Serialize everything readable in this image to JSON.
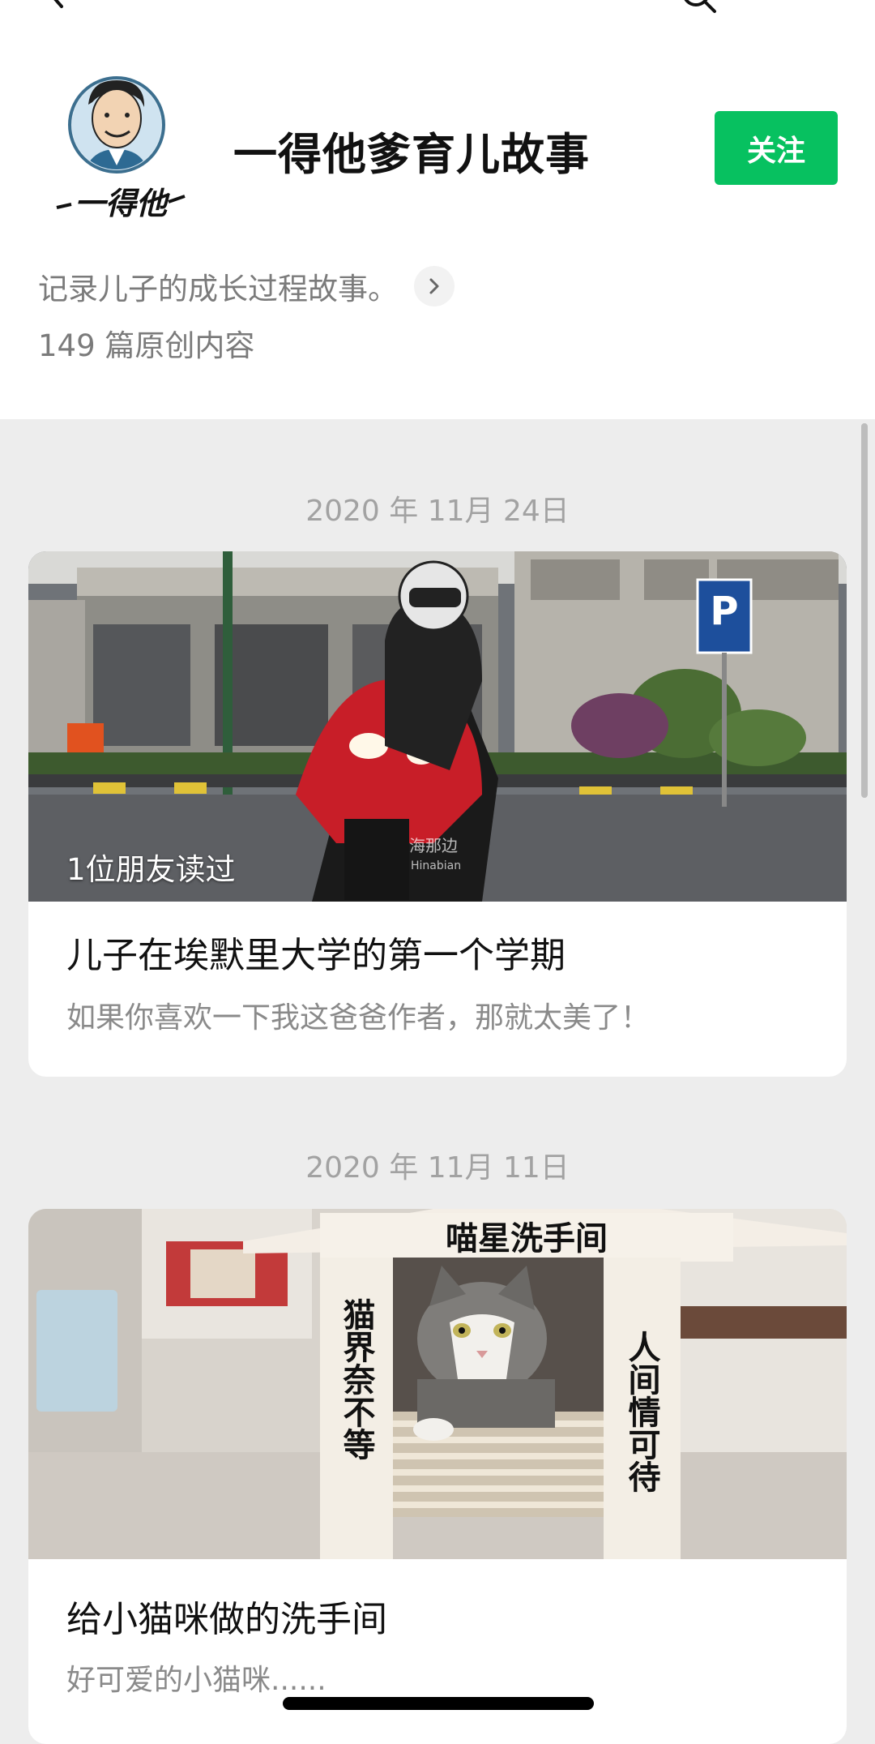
{
  "nav": {
    "back_icon": "chevron-left-icon",
    "search_icon": "search-icon"
  },
  "profile": {
    "name": "一得他爹育儿故事",
    "follow_label": "关注",
    "description": "记录儿子的成长过程故事。",
    "original_count": "149 篇原创内容",
    "avatar_text": "一得他",
    "accent_color": "#07c160"
  },
  "articles": [
    {
      "date": "2020 年 11月 24日",
      "friends_read": "1位朋友读过",
      "title": "儿子在埃默里大学的第一个学期",
      "summary": "如果你喜欢一下我这爸爸作者，那就太美了！",
      "watermark": "海那边",
      "watermark_sub": "Hinabian"
    },
    {
      "date": "2020 年 11月 11日",
      "title": "给小猫咪做的洗手间",
      "summary": "好可爱的小猫咪......",
      "sign_top": "喵星洗手间",
      "sign_left": "猫界奈不等",
      "sign_right": "人间情可待"
    }
  ]
}
